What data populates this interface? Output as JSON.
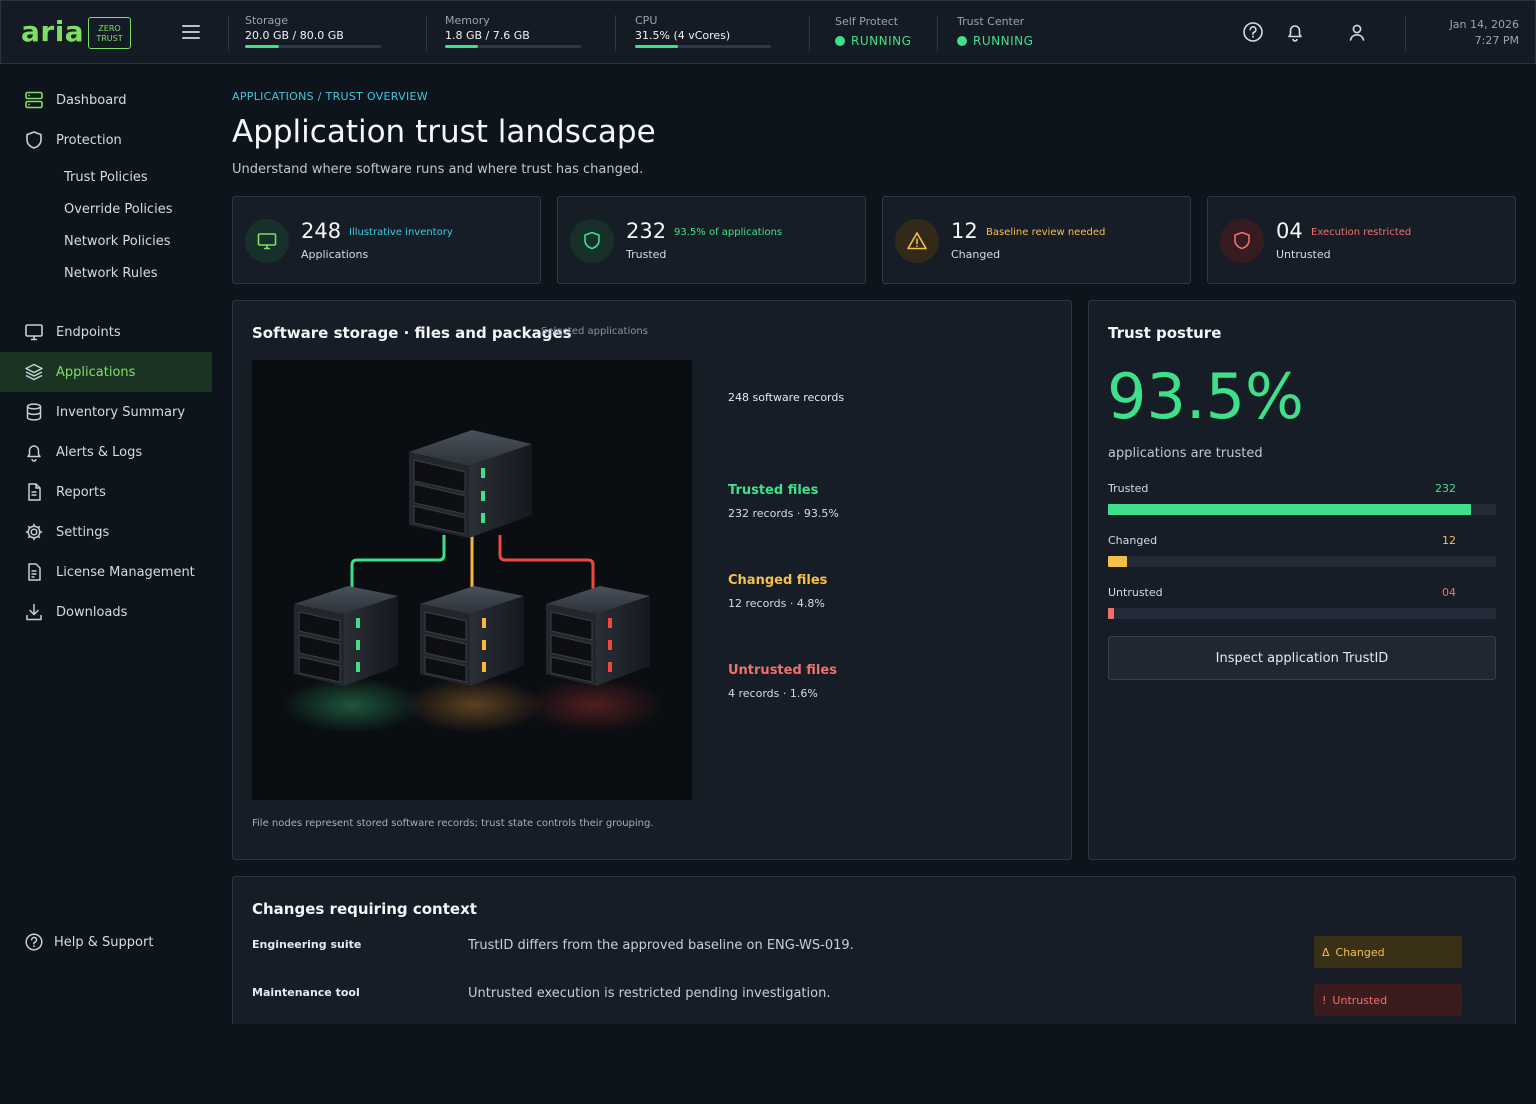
{
  "brand": {
    "name": "aria",
    "badge_line1": "ZERO",
    "badge_line2": "TRUST",
    "accent": "#7ee063"
  },
  "topbar": {
    "metrics": [
      {
        "label": "Storage",
        "value": "20.0 GB / 80.0 GB",
        "fraction": 0.25
      },
      {
        "label": "Memory",
        "value": "1.8 GB / 7.6 GB",
        "fraction": 0.24
      },
      {
        "label": "CPU",
        "value": "31.5% (4 vCores)",
        "fraction": 0.315
      }
    ],
    "statuses": [
      {
        "label": "Self Protect",
        "value": "RUNNING"
      },
      {
        "label": "Trust Center",
        "value": "RUNNING"
      }
    ],
    "icons": [
      "help-icon",
      "bell-icon",
      "user-icon"
    ],
    "date": "Jan 14, 2026",
    "time": "7:27 PM"
  },
  "sidebar": {
    "items": [
      {
        "label": "Dashboard",
        "icon": "server-stack-icon"
      },
      {
        "label": "Protection",
        "icon": "shield-icon"
      },
      {
        "label": "Endpoints",
        "icon": "monitor-icon"
      },
      {
        "label": "Applications",
        "icon": "layers-icon",
        "active": true
      },
      {
        "label": "Inventory Summary",
        "icon": "database-icon"
      },
      {
        "label": "Alerts & Logs",
        "icon": "bell-icon"
      },
      {
        "label": "Reports",
        "icon": "document-icon"
      },
      {
        "label": "Settings",
        "icon": "gear-icon"
      },
      {
        "label": "License Management",
        "icon": "license-icon"
      },
      {
        "label": "Downloads",
        "icon": "download-icon"
      }
    ],
    "protection_sub": [
      "Trust Policies",
      "Override Policies",
      "Network Policies",
      "Network Rules"
    ],
    "help": "Help & Support"
  },
  "page": {
    "breadcrumb": "APPLICATIONS / TRUST OVERVIEW",
    "title": "Application trust landscape",
    "subtitle": "Understand where software runs and where trust has changed."
  },
  "stats": [
    {
      "value": "248",
      "note": "Illustrative inventory",
      "label": "Applications",
      "color": "#3dc9e0",
      "icon": "monitor-icon"
    },
    {
      "value": "232",
      "note": "93.5% of applications",
      "label": "Trusted",
      "color": "#3fe08a",
      "icon": "shield-icon"
    },
    {
      "value": "12",
      "note": "Baseline review needed",
      "label": "Changed",
      "color": "#f5c04a",
      "icon": "warning-icon"
    },
    {
      "value": "04",
      "note": "Execution restricted",
      "label": "Untrusted",
      "color": "#f0716a",
      "icon": "shield-alert-icon"
    }
  ],
  "storage": {
    "title": "Software storage · files and packages",
    "tag": "Selected applications",
    "records_total": "248 software records",
    "groups": [
      {
        "title": "Trusted files",
        "detail": "232 records · 93.5%",
        "color": "#3fe08a"
      },
      {
        "title": "Changed files",
        "detail": "12 records · 4.8%",
        "color": "#f5c04a"
      },
      {
        "title": "Untrusted files",
        "detail": "4 records · 1.6%",
        "color": "#f0716a"
      }
    ],
    "footnote": "File nodes represent stored software records; trust state controls their grouping."
  },
  "posture": {
    "title": "Trust posture",
    "percent": "93.5%",
    "caption": "applications are trusted",
    "bars": [
      {
        "label": "Trusted",
        "count": "232",
        "fraction": 0.935,
        "color": "#3fe08a"
      },
      {
        "label": "Changed",
        "count": "12",
        "fraction": 0.048,
        "color": "#f5c04a"
      },
      {
        "label": "Untrusted",
        "count": "04",
        "fraction": 0.016,
        "color": "#f0716a"
      }
    ],
    "button": "Inspect application TrustID"
  },
  "changes": {
    "title": "Changes requiring context",
    "rows": [
      {
        "name": "Engineering suite",
        "desc": "TrustID differs from the approved baseline on ENG-WS-019.",
        "badge_icon": "Δ",
        "badge": "Changed",
        "color": "#f5c04a",
        "bg": "#3a2f17"
      },
      {
        "name": "Maintenance tool",
        "desc": "Untrusted execution is restricted pending investigation.",
        "badge_icon": "!",
        "badge": "Untrusted",
        "color": "#f0716a",
        "bg": "#3a1c1f"
      }
    ]
  }
}
